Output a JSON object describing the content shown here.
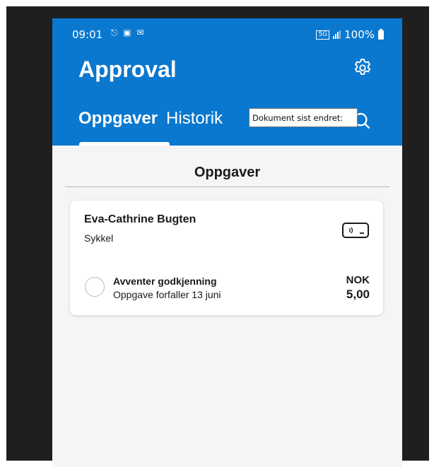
{
  "status_bar": {
    "time": "09:01",
    "left_icons": "⎋ ▣ ✉",
    "network_label": "5G",
    "battery": "100%"
  },
  "header": {
    "title": "Approval",
    "settings_icon": "gear-icon"
  },
  "tabs": {
    "active_label": "Oppgaver",
    "inactive_label": "Historik"
  },
  "tooltip": {
    "text": "Dokument sist endret:"
  },
  "section": {
    "title": "Oppgaver"
  },
  "task_card": {
    "name": "Eva-Cathrine Bugten",
    "category": "Sykkel",
    "status": "Avventer godkjenning",
    "due": "Oppgave forfaller 13 juni",
    "currency": "NOK",
    "amount": "5,00"
  },
  "colors": {
    "header_bg": "#0a78cf",
    "page_bg": "#f4f5f7",
    "frame_bg": "#1f1f1f"
  }
}
